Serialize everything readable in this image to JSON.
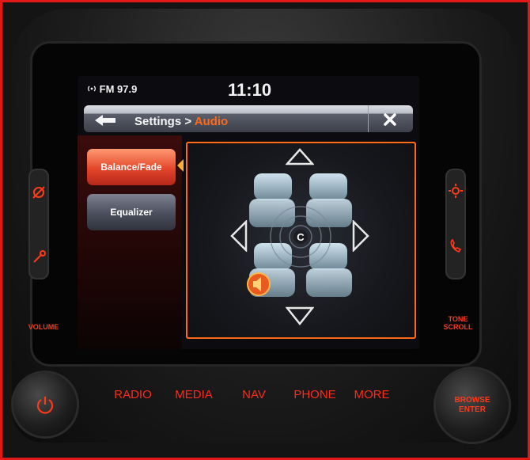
{
  "status_bar": {
    "radio": "FM 97.9",
    "clock": "11:10"
  },
  "header": {
    "breadcrumb_prefix": "Settings > ",
    "breadcrumb_current": "Audio"
  },
  "sidebar": {
    "items": [
      {
        "label": "Balance/Fade",
        "active": true
      },
      {
        "label": "Equalizer",
        "active": false
      }
    ]
  },
  "balance_fade": {
    "center_label": "C"
  },
  "hardware_buttons": {
    "radio": "RADIO",
    "media": "MEDIA",
    "nav": "NAV",
    "phone": "PHONE",
    "more": "MORE"
  },
  "knobs": {
    "left_label": "VOLUME",
    "right_label": "TONE SCROLL",
    "right_knob_text": "BROWSE ENTER"
  },
  "colors": {
    "accent": "#ff6a1a",
    "hardware_label": "#ff2a1a"
  }
}
